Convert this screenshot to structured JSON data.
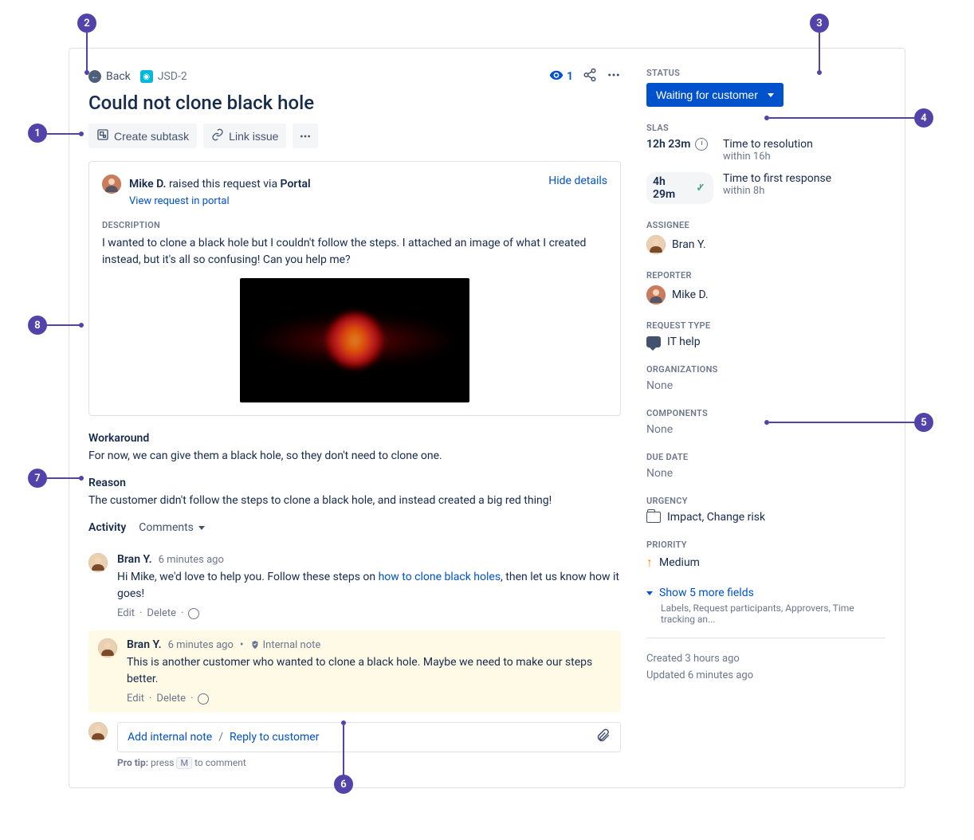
{
  "header": {
    "back_label": "Back",
    "issue_key": "JSD-2",
    "title": "Could not clone black hole",
    "watch_count": "1"
  },
  "actions": {
    "create_subtask": "Create subtask",
    "link_issue": "Link issue"
  },
  "request": {
    "requester_name": "Mike D.",
    "raised_text": " raised this request via ",
    "raised_via": "Portal",
    "view_portal": "View request in portal",
    "hide_details": "Hide details",
    "description_label": "DESCRIPTION",
    "description_text": "I wanted to clone a black hole but I couldn't follow the steps. I attached an image of what I created instead, but it's all so confusing! Can you help me?"
  },
  "workaround": {
    "label": "Workaround",
    "text": "For now, we can give them a black hole, so they don't need to clone one."
  },
  "reason": {
    "label": "Reason",
    "text": "The customer didn't follow the steps to clone a black hole, and instead created a big red thing!"
  },
  "activity": {
    "label": "Activity",
    "filter": "Comments",
    "comments": [
      {
        "author": "Bran Y.",
        "time": "6 minutes ago",
        "pre": "Hi Mike, we'd love to help you. Follow these steps on ",
        "link": "how to clone black holes",
        "post": ", then let us know how it goes!",
        "internal": false
      },
      {
        "author": "Bran Y.",
        "time": "6 minutes ago",
        "internal_label": "Internal note",
        "text": "This is another customer who wanted to clone a black hole. Maybe we need to make our steps better.",
        "internal": true
      }
    ],
    "edit": "Edit",
    "delete": "Delete",
    "reply": {
      "internal": "Add internal note",
      "customer": "Reply to customer"
    },
    "protip_pre": "Pro tip:",
    "protip_mid": " press ",
    "protip_key": "M",
    "protip_post": " to comment"
  },
  "sidebar": {
    "status_label": "STATUS",
    "status_value": "Waiting for customer",
    "slas_label": "SLAs",
    "slas": [
      {
        "time": "12h 23m",
        "name": "Time to resolution",
        "within": "within 16h",
        "icon": "clock"
      },
      {
        "time": "4h 29m",
        "name": "Time to first response",
        "within": "within 8h",
        "icon": "check"
      }
    ],
    "assignee_label": "ASSIGNEE",
    "assignee": "Bran Y.",
    "reporter_label": "REPORTER",
    "reporter": "Mike D.",
    "request_type_label": "REQUEST TYPE",
    "request_type": "IT help",
    "organizations_label": "ORGANIZATIONS",
    "organizations": "None",
    "components_label": "COMPONENTS",
    "components": "None",
    "due_date_label": "DUE DATE",
    "due_date": "None",
    "urgency_label": "URGENCY",
    "urgency": "Impact, Change risk",
    "priority_label": "PRIORITY",
    "priority": "Medium",
    "show_more": "Show 5 more fields",
    "show_more_sub": "Labels, Request participants, Approvers, Time tracking an...",
    "created": "Created 3 hours ago",
    "updated": "Updated 6 minutes ago"
  },
  "callouts": [
    "1",
    "2",
    "3",
    "4",
    "5",
    "6",
    "7",
    "8"
  ]
}
